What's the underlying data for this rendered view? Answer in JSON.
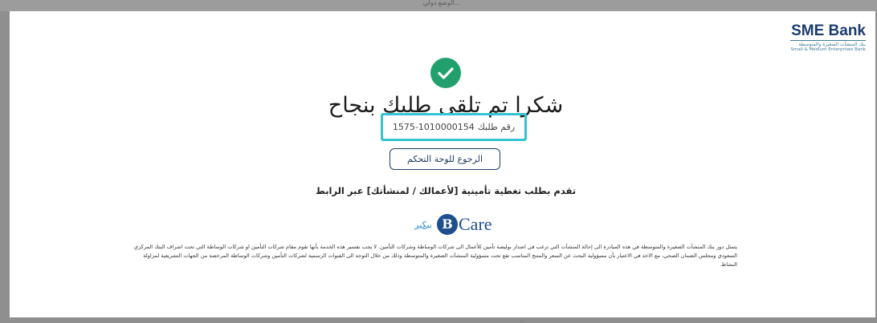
{
  "backdrop": {
    "top_text": "الوضع دولي...",
    "bottom_text": "..."
  },
  "brand": {
    "name": "SME Bank",
    "arabic_name": "بنك المنشآت الصغيرة والمتوسطة",
    "english_name": "Small & Medium Enterprises Bank",
    "primary_color": "#1a3c6e",
    "accent_color": "#3d7a9a"
  },
  "success": {
    "icon": "check-circle-icon",
    "color": "#21a06b",
    "title": "شكرا تم تلقى طلبك بنجاح"
  },
  "request": {
    "label": "رقم طلبك",
    "number": "1575-1010000154",
    "highlight_color": "#33c3d2"
  },
  "actions": {
    "back_label": "الرجوع للوحة التحكم"
  },
  "promo": {
    "text": "تقدم بطلب تغطية تأمينية [لأعمالك / لمنشأتك] عبر الرابط"
  },
  "partners": {
    "bcare_logo_text": "Care",
    "bcare_logo_letter": "B",
    "link_label": "بيكير"
  },
  "disclaimer": "يتمثل دور بنك المنشآت الصغيرة والمتوسطة في هذه المبادرة الى إحالة المنشآت التي ترغب في اصدار بوليصة تأمين للأعمال الى شركات الوساطة وشركات التأمين. لا يجب تفسير هذه الخدمة بأنها تقوم مقام شركات التأمين او شركات الوساطة التي تحت اشراف البنك المركزي السعودي ومجلس الضمان الصحي، مع الاخذ في الاعتبار بأن مسؤولية البحث عن السعر والمنتج المناسب تقع تحت مسؤولية المنشآت الصغيرة والمتوسطة وذلك من خلال التوجه الى القنوات الرسمية لشركات التأمين وشركات الوساطة المرخصة من الجهات التشريعية لمزاولة النشاط."
}
